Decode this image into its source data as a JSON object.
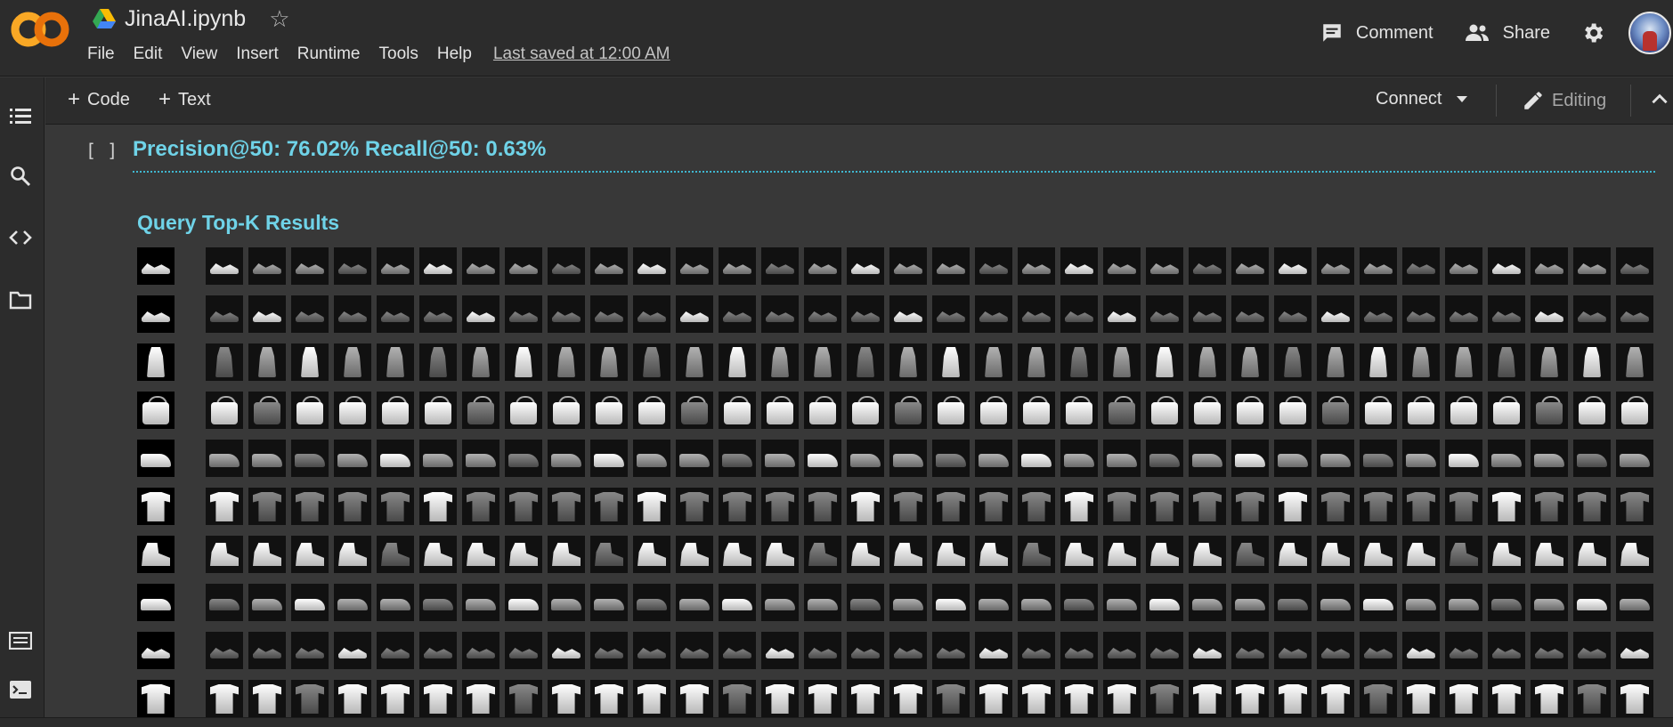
{
  "app": {
    "notebook_title": "JinaAI.ipynb",
    "menu": [
      "File",
      "Edit",
      "View",
      "Insert",
      "Runtime",
      "Tools",
      "Help"
    ],
    "last_saved": "Last saved at 12:00 AM",
    "comment_label": "Comment",
    "share_label": "Share",
    "accent": "#6fd3e8"
  },
  "toolbar": {
    "code_label": "Code",
    "text_label": "Text",
    "connect_label": "Connect",
    "editing_label": "Editing"
  },
  "cell": {
    "bracket": "[ ]",
    "metric_text": "Precision@50: 76.02% Recall@50: 0.63%",
    "results_title": "Query Top-K Results"
  },
  "results": {
    "rows": [
      {
        "category": "sandal",
        "tone": "mid"
      },
      {
        "category": "sandal",
        "tone": "dim"
      },
      {
        "category": "dress",
        "tone": "mid"
      },
      {
        "category": "bag",
        "tone": "bright"
      },
      {
        "category": "shoe",
        "tone": "mid"
      },
      {
        "category": "tee",
        "tone": "dim"
      },
      {
        "category": "boot",
        "tone": "bright"
      },
      {
        "category": "sneaker",
        "tone": "mid"
      },
      {
        "category": "sandal",
        "tone": "dim"
      },
      {
        "category": "tee",
        "tone": "bright"
      }
    ]
  }
}
